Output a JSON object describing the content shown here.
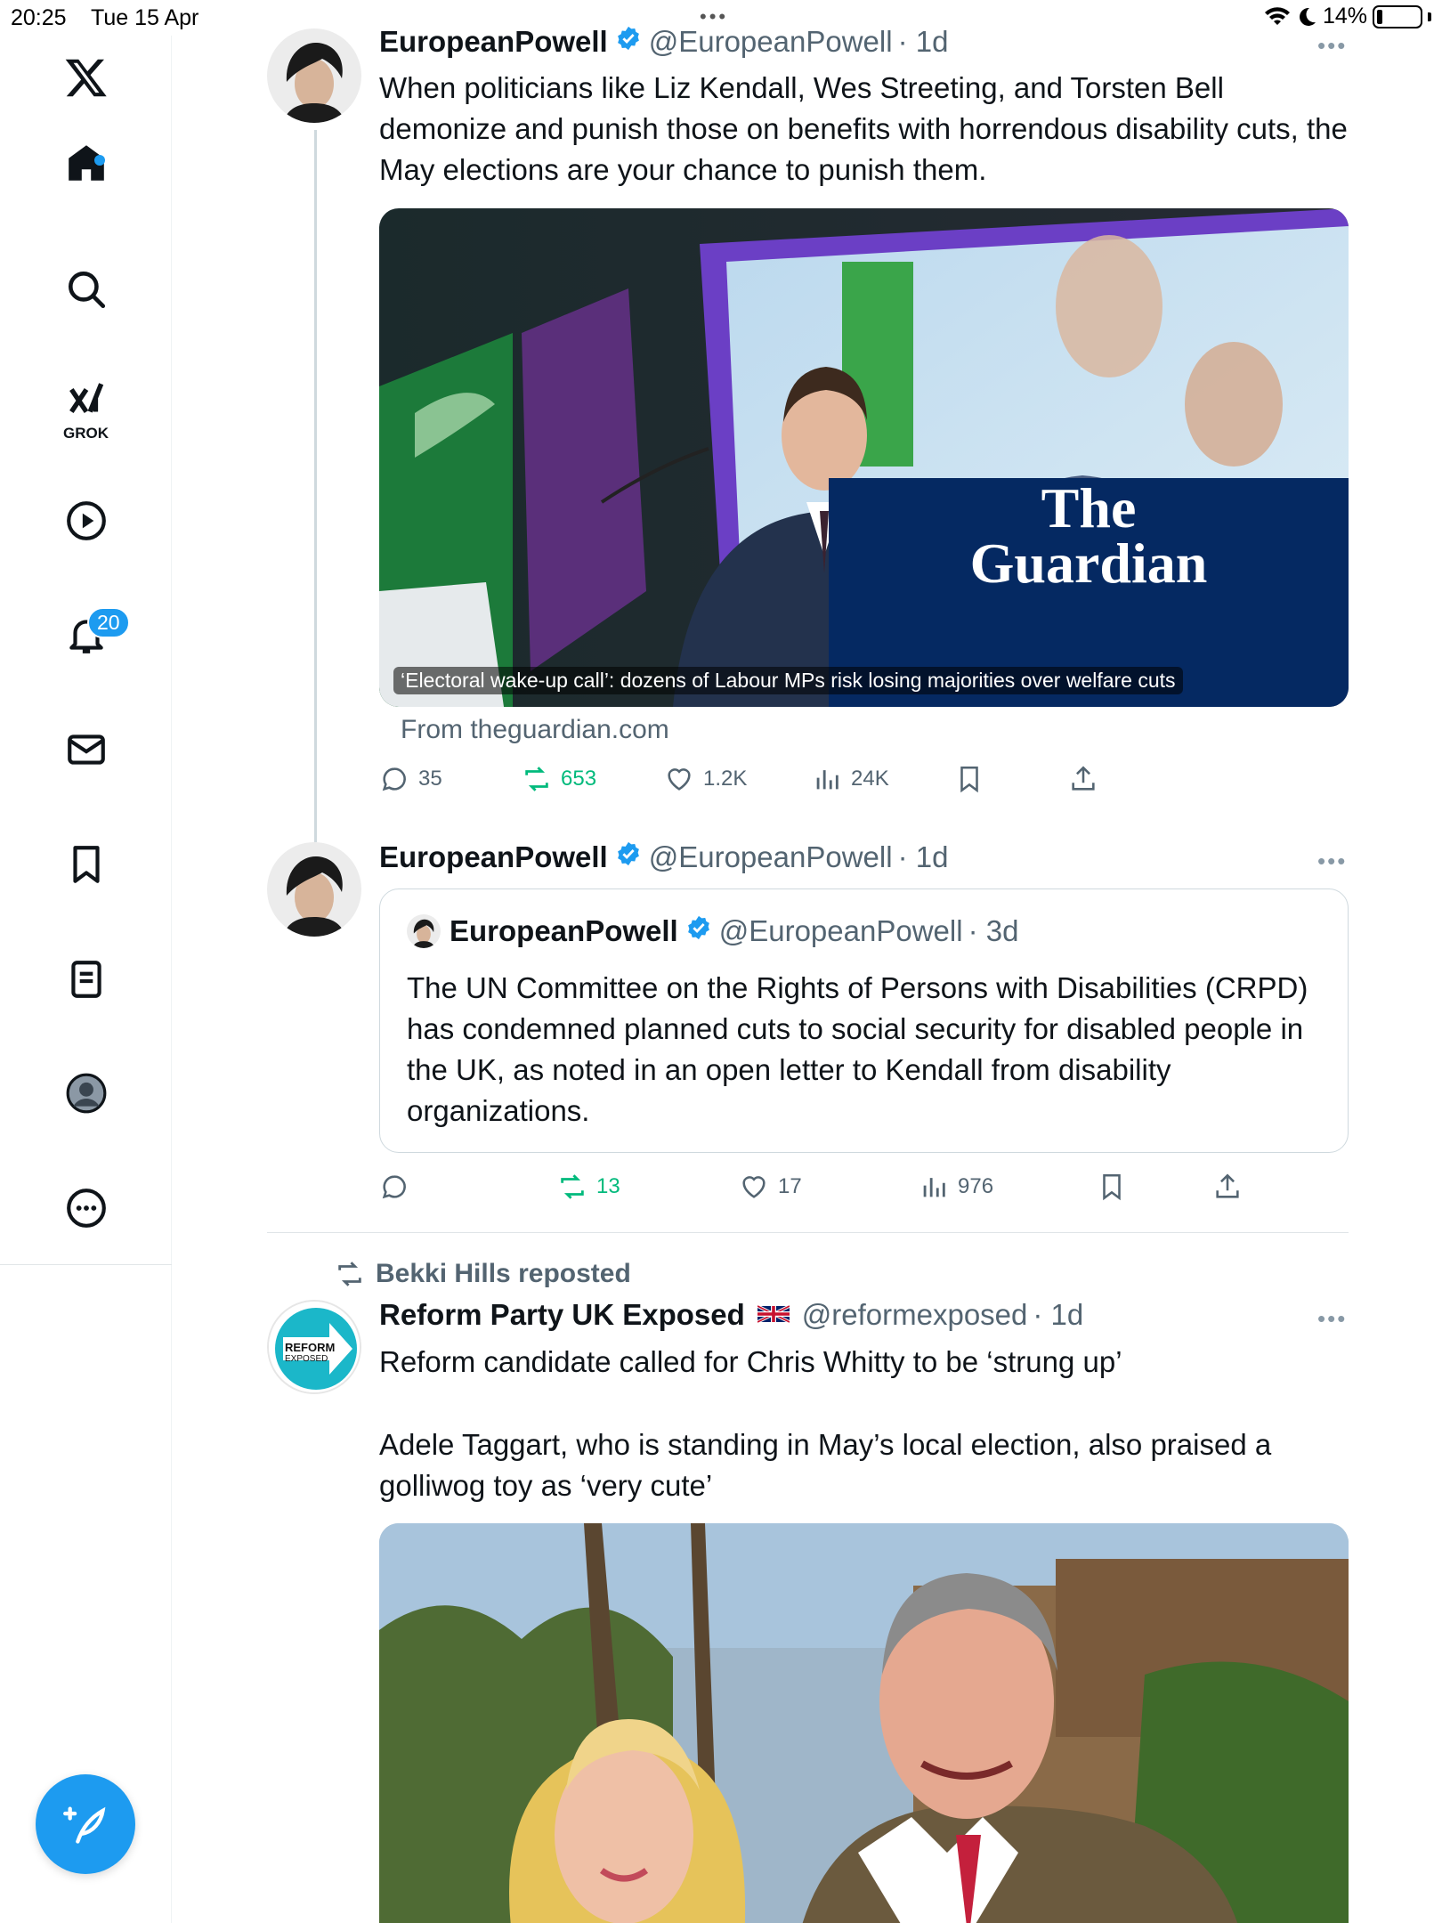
{
  "status_bar": {
    "time": "20:25",
    "date": "Tue 15 Apr",
    "battery": "14%"
  },
  "sidebar": {
    "grok_label": "GROK",
    "notifications_badge": "20",
    "accent_color": "#1d9bf0"
  },
  "tweets": [
    {
      "name": "EuropeanPowell",
      "handle": "@EuropeanPowell",
      "time": "· 1d",
      "text": "When politicians like Liz Kendall, Wes Streeting, and Torsten Bell demonize and punish those on benefits with horrendous disability cuts, the May elections are your chance to punish them.",
      "card": {
        "caption": "‘Electoral wake-up call’: dozens of Labour MPs risk losing majorities over welfare cuts",
        "logo": "The Guardian",
        "from": "From theguardian.com"
      },
      "stats": {
        "replies": "35",
        "reposts": "653",
        "likes": "1.2K",
        "views": "24K"
      }
    },
    {
      "name": "EuropeanPowell",
      "handle": "@EuropeanPowell",
      "time": "· 1d",
      "quote": {
        "name": "EuropeanPowell",
        "handle": "@EuropeanPowell",
        "time": "· 3d",
        "text": "The UN Committee on the Rights of Persons with Disabilities (CRPD) has condemned planned cuts to social security for disabled people in the UK, as noted in an open letter to Kendall from disability organizations."
      },
      "stats": {
        "replies": "",
        "reposts": "13",
        "likes": "17",
        "views": "976"
      }
    },
    {
      "reposted_by": "Bekki Hills reposted",
      "name": "Reform Party UK Exposed",
      "handle": "@reformexposed",
      "time": "· 1d",
      "avatar_text_1": "REFORM",
      "avatar_text_2": "EXPOSED",
      "text_1": "Reform candidate called for Chris Whitty to be ‘strung up’",
      "text_2": "Adele Taggart, who is standing in May’s local election, also praised a golliwog toy as ‘very cute’"
    }
  ]
}
